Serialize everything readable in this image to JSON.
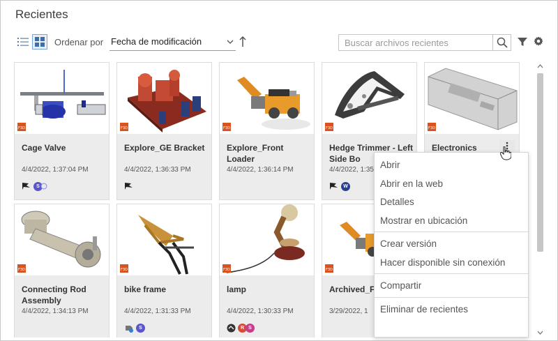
{
  "title": "Recientes",
  "toolbar": {
    "list_view_icon": "list-icon",
    "grid_view_icon": "grid-icon",
    "sort_label": "Ordenar por",
    "sort_value": "Fecha de modificación",
    "search_placeholder": "Buscar archivos recientes"
  },
  "colors": {
    "accent": "#0696d7",
    "card_bg": "#ececec",
    "f3d_badge": "#d9531e"
  },
  "files": [
    {
      "name": "Cage Valve",
      "date": "4/4/2022, 1:37:04 PM",
      "icons": [
        "flag-icon",
        "shared-avatar-s"
      ]
    },
    {
      "name": "Explore_GE Bracket",
      "date": "4/4/2022, 1:36:33 PM",
      "icons": [
        "flag-icon"
      ]
    },
    {
      "name": "Explore_Front Loader",
      "date": "4/4/2022, 1:36:14 PM",
      "icons": []
    },
    {
      "name": "Hedge Trimmer - Left Side Bo",
      "date": "4/4/2022, 1:35:",
      "icons": [
        "flag-icon",
        "avatar-w"
      ]
    },
    {
      "name": "Electronics",
      "date": "",
      "icons": []
    },
    {
      "name": "Connecting Rod Assembly",
      "date": "4/4/2022, 1:34:13 PM",
      "icons": []
    },
    {
      "name": "bike frame",
      "date": "4/4/2022, 1:31:33 PM",
      "icons": [
        "linked-icon",
        "shared-avatar-s"
      ]
    },
    {
      "name": "lamp",
      "date": "4/4/2022, 1:30:33 PM",
      "icons": [
        "collab-icon",
        "avatar-r",
        "avatar-s"
      ]
    },
    {
      "name": "Archived_Fr Loader",
      "date": "3/29/2022, 1",
      "icons": []
    }
  ],
  "avatars": {
    "s": "S",
    "w": "W",
    "r": "R"
  },
  "context_menu": {
    "items": [
      "Abrir",
      "Abrir en la web",
      "Detalles",
      "Mostrar en ubicación",
      "Crear versión",
      "Hacer disponible sin conexión",
      "Compartir",
      "Eliminar de recientes"
    ]
  }
}
